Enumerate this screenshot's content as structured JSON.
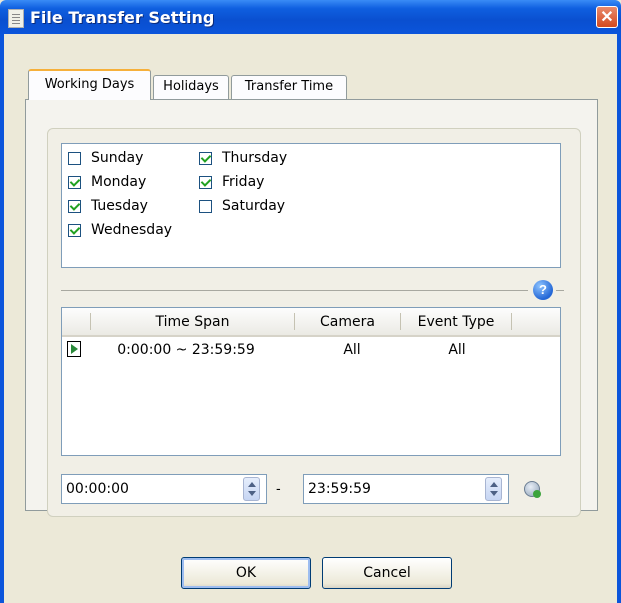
{
  "window": {
    "title": "File Transfer Setting",
    "close_label": "✕"
  },
  "tabs": [
    {
      "label": "Working Days",
      "active": true
    },
    {
      "label": "Holidays",
      "active": false
    },
    {
      "label": "Transfer Time",
      "active": false
    }
  ],
  "days": [
    {
      "label": "Sunday",
      "checked": false
    },
    {
      "label": "Monday",
      "checked": true
    },
    {
      "label": "Tuesday",
      "checked": true
    },
    {
      "label": "Wednesday",
      "checked": true
    },
    {
      "label": "Thursday",
      "checked": true
    },
    {
      "label": "Friday",
      "checked": true
    },
    {
      "label": "Saturday",
      "checked": false
    }
  ],
  "help_label": "?",
  "grid": {
    "columns": [
      "Time Span",
      "Camera",
      "Event Type"
    ],
    "rows": [
      {
        "time_span": "0:00:00 ~ 23:59:59",
        "camera": "All",
        "event_type": "All"
      }
    ]
  },
  "time_range": {
    "start": "00:00:00",
    "separator": "-",
    "end": "23:59:59"
  },
  "buttons": {
    "ok": "OK",
    "cancel": "Cancel"
  }
}
